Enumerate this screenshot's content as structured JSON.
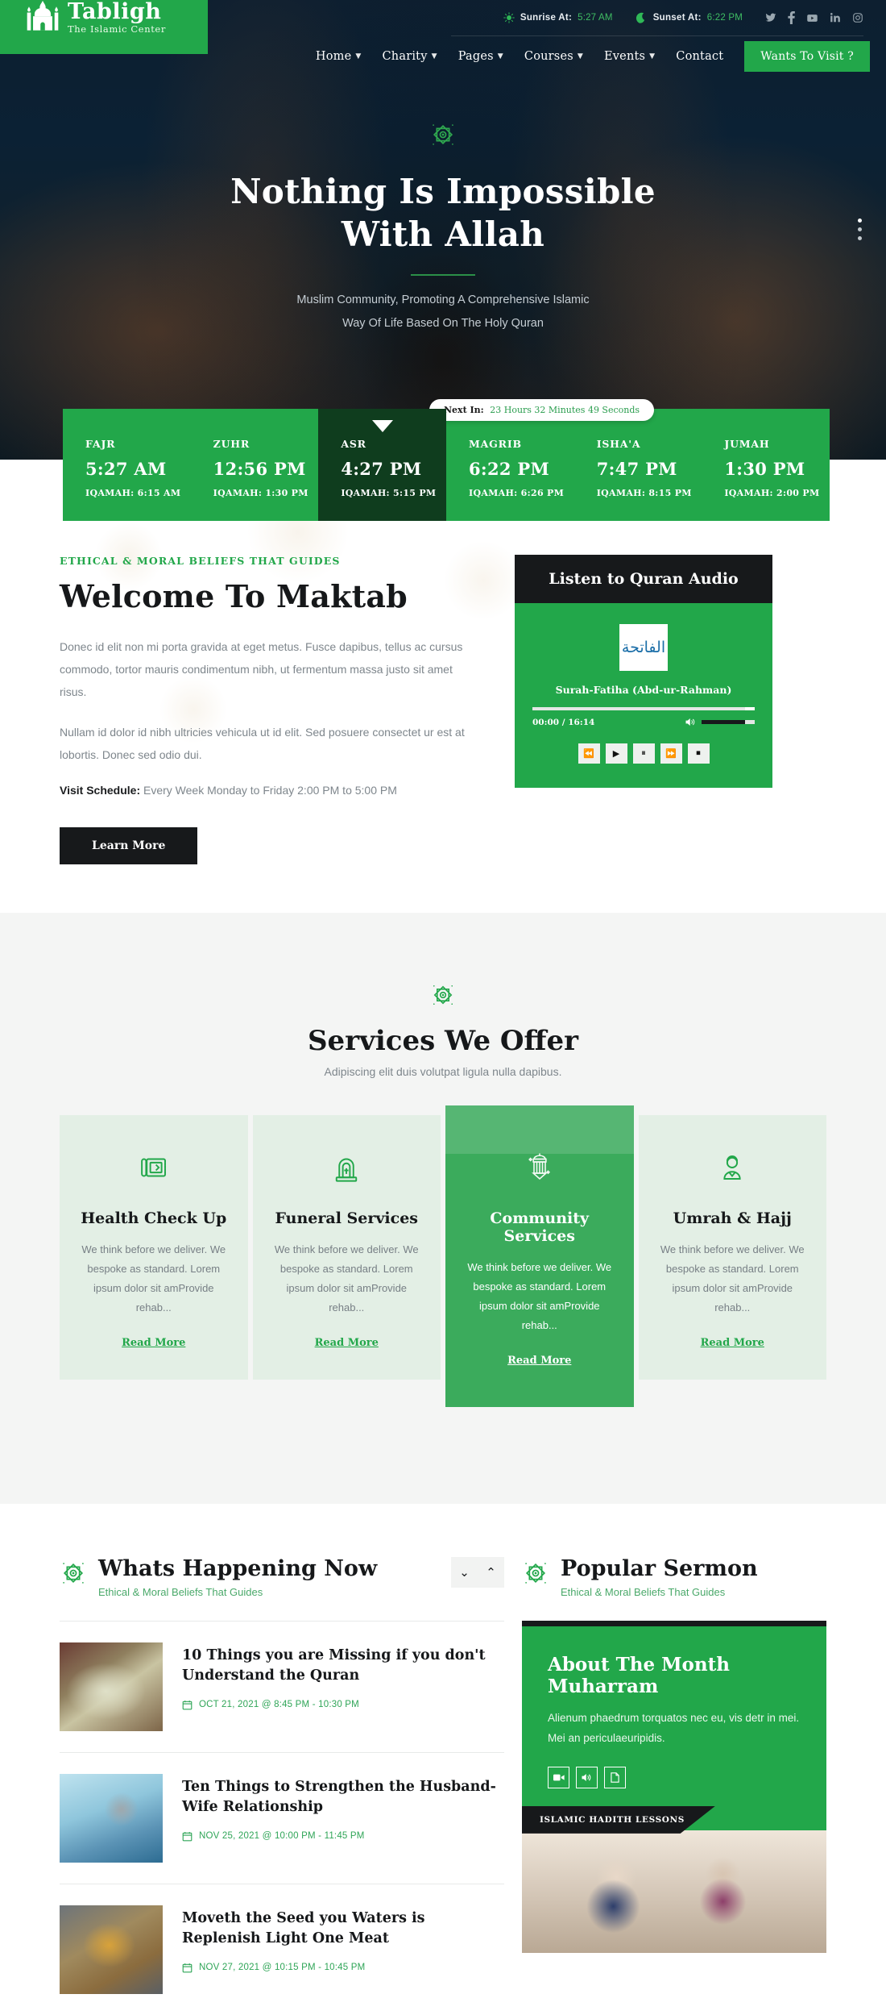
{
  "brand": {
    "name": "Tabligh",
    "tagline": "The Islamic Center",
    "green": "#22a74a",
    "dark": "#17191b"
  },
  "topbar": {
    "sunrise_label": "Sunrise At:",
    "sunrise_value": "5:27 AM",
    "sunset_label": "Sunset At:",
    "sunset_value": "6:22 PM",
    "social": [
      "twitter-icon",
      "facebook-icon",
      "youtube-icon",
      "linkedin-icon",
      "instagram-icon"
    ]
  },
  "nav": {
    "items": [
      {
        "label": "Home",
        "has_caret": true
      },
      {
        "label": "Charity",
        "has_caret": true
      },
      {
        "label": "Pages",
        "has_caret": true
      },
      {
        "label": "Courses",
        "has_caret": true
      },
      {
        "label": "Events",
        "has_caret": true
      },
      {
        "label": "Contact",
        "has_caret": false
      }
    ],
    "cta": "Wants To Visit ?"
  },
  "hero": {
    "title_line1": "Nothing Is Impossible",
    "title_line2": "With Allah",
    "sub_line1": "Muslim Community, Promoting A Comprehensive Islamic",
    "sub_line2": "Way Of Life Based On The Holy Quran"
  },
  "prayer": {
    "next_label": "Next In:",
    "next_value": "23 Hours 32 Minutes 49 Seconds",
    "times": [
      {
        "name": "FAJR",
        "time": "5:27 AM",
        "iqamah": "IQAMAH: 6:15 AM",
        "active": false
      },
      {
        "name": "ZUHR",
        "time": "12:56 PM",
        "iqamah": "IQAMAH: 1:30 PM",
        "active": false
      },
      {
        "name": "ASR",
        "time": "4:27 PM",
        "iqamah": "IQAMAH: 5:15 PM",
        "active": true
      },
      {
        "name": "MAGRIB",
        "time": "6:22 PM",
        "iqamah": "IQAMAH: 6:26 PM",
        "active": false
      },
      {
        "name": "ISHA'A",
        "time": "7:47 PM",
        "iqamah": "IQAMAH: 8:15 PM",
        "active": false
      },
      {
        "name": "JUMAH",
        "time": "1:30 PM",
        "iqamah": "IQAMAH: 2:00 PM",
        "active": false
      }
    ]
  },
  "welcome": {
    "eyebrow": "ETHICAL & MORAL BELIEFS THAT GUIDES",
    "title": "Welcome To Maktab",
    "p1": "Donec id elit non mi porta gravida at eget metus. Fusce dapibus, tellus ac cursus commodo, tortor mauris condimentum nibh, ut fermentum massa justo sit amet risus.",
    "p2": "Nullam id dolor id nibh ultricies vehicula ut id elit. Sed posuere consectet ur est at lobortis. Donec sed odio dui.",
    "schedule_label": "Visit Schedule:",
    "schedule_value": "Every Week Monday to Friday 2:00 PM to 5:00 PM",
    "button": "Learn More"
  },
  "audio": {
    "header": "Listen to Quran Audio",
    "cover_text": "الفاتحة",
    "track": "Surah-Fatiha (Abd-ur-Rahman)",
    "time": "00:00 / 16:14",
    "controls": [
      "rewind-icon",
      "play-icon",
      "pause-icon",
      "fast-forward-icon",
      "stop-icon"
    ]
  },
  "services": {
    "title": "Services We Offer",
    "subtitle": "Adipiscing elit duis volutpat ligula nulla dapibus.",
    "cards": [
      {
        "icon": "prayer-rug-icon",
        "title": "Health Check Up",
        "text": "We think before we deliver. We bespoke as standard. Lorem ipsum dolor sit amProvide rehab...",
        "read": "Read More",
        "highlight": false
      },
      {
        "icon": "gravestone-icon",
        "title": "Funeral Services",
        "text": "We think before we deliver. We bespoke as standard. Lorem ipsum dolor sit amProvide rehab...",
        "read": "Read More",
        "highlight": false
      },
      {
        "icon": "lantern-icon",
        "title": "Community Services",
        "text": "We think before we deliver. We bespoke as standard. Lorem ipsum dolor sit amProvide rehab...",
        "read": "Read More",
        "highlight": true
      },
      {
        "icon": "pilgrim-icon",
        "title": "Umrah & Hajj",
        "text": "We think before we deliver. We bespoke as standard. Lorem ipsum dolor sit amProvide rehab...",
        "read": "Read More",
        "highlight": false
      }
    ]
  },
  "happening": {
    "title": "Whats Happening Now",
    "subtitle": "Ethical & Moral Beliefs That Guides",
    "prev_icon": "chevron-down-icon",
    "next_icon": "chevron-up-icon",
    "items": [
      {
        "title": "10 Things you are Missing if you don't Understand the Quran",
        "date": "OCT 21, 2021 @ 8:45 PM - 10:30 PM"
      },
      {
        "title": "Ten Things to Strengthen the Husband-Wife Relationship",
        "date": "NOV 25, 2021 @ 10:00 PM - 11:45 PM"
      },
      {
        "title": "Moveth the Seed you Waters is Replenish Light One Meat",
        "date": "NOV 27, 2021 @ 10:15 PM - 10:45 PM"
      }
    ]
  },
  "sermon": {
    "title": "Popular Sermon",
    "subtitle": "Ethical & Moral Beliefs That Guides",
    "card_title": "About The Month Muharram",
    "card_text": "Alienum phaedrum torquatos nec eu, vis detr in mei. Mei an periculaeuripidis.",
    "icons": [
      "video-icon",
      "audio-icon",
      "document-icon"
    ],
    "tag": "ISLAMIC HADITH LESSONS"
  }
}
